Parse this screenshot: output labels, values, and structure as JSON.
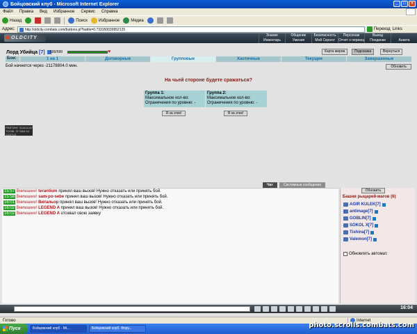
{
  "window": {
    "title": "Бойцовский клуб - Microsoft Internet Explorer"
  },
  "menubar": {
    "items": [
      "Файл",
      "Правка",
      "Вид",
      "Избранное",
      "Сервис",
      "Справка"
    ]
  },
  "toolbar": {
    "back_label": "Назад",
    "search_label": "Поиск",
    "favorites_label": "Избранное",
    "media_label": "Медиа"
  },
  "addressbar": {
    "label": "Адрес:",
    "url": "http://oldcity.combats.com/buttons.pl?battle=0.733150039952125",
    "go_label": "Переход",
    "links_label": "Links"
  },
  "game": {
    "logo": "OLDCITY",
    "topnav": [
      "Знание",
      "Общение",
      "Безопасность",
      "Персонаж",
      "Выход",
      "Инвентарь",
      "Умения",
      "Мой Скролл",
      "Отчет о переводах",
      "Поединки",
      "Анкета"
    ],
    "character": {
      "name": "Лорд Убийца",
      "level": "[7]",
      "hp": "599/599",
      "hp_fraction": 1.0
    },
    "buttons": {
      "map": "Карта миров",
      "hint": "Подсказка",
      "back": "Вернуться",
      "refresh": "Обновить"
    },
    "tabs": {
      "label": "Бои:",
      "items": [
        "1 на 1",
        "Договорные",
        "Групповые",
        "Хаотичные",
        "Текущие",
        "Завершенные"
      ]
    },
    "battle_start": "Бой начнется через -21178804.0 мин.",
    "question": "На чьей стороне будете сражаться?",
    "groups": [
      {
        "title": "Группа 1:",
        "max": "Максимальное кол-во:",
        "limits": "Ограничения по уровню: -"
      },
      {
        "title": "Группа 2:",
        "max": "Максимальное кол-во:",
        "limits": "Ограничения по уровню: -"
      }
    ],
    "join_label": "Я за этих!",
    "banner_lines": [
      "РЕЙТИНГ 0116112478",
      "TOOBL 37 SAN 04",
      "CASTLE"
    ]
  },
  "chat": {
    "tab_chat": "Чат",
    "tab_system": "Системные сообщения",
    "messages": [
      {
        "time": "15:57",
        "warn": "Внимание!",
        "nick": "terantium",
        "text": "принял ваш вызов! Нужно отказать или принять бой."
      },
      {
        "time": "15:58",
        "warn": "Внимание!",
        "nick": "sam-po-sebe",
        "text": "принял ваш вызов! Нужно отказать или принять бой."
      },
      {
        "time": "16:01",
        "warn": "Внимание!",
        "nick": "Витальор",
        "text": "принял ваш вызов! Нужно отказать или принять бой."
      },
      {
        "time": "16:02",
        "warn": "Внимание!",
        "nick": "LEGEND A",
        "text": "принял ваш вызов! Нужно отказать или принять бой."
      },
      {
        "time": "16:02",
        "warn": "Внимание!",
        "nick": "LEGEND A",
        "text": "отозвал свою заявку"
      }
    ],
    "clock": "16:04"
  },
  "room": {
    "update_label": "Обновить",
    "title": "Башня рыцарей-магов (6)",
    "players": [
      "AGIR KULEK[7]",
      "antimage[7]",
      "GOBLIN[7]",
      "SOKOL X[7]",
      "Tishina[7]",
      "Valemon[7]"
    ],
    "auto_update": "Обновлять автомат."
  },
  "statusbar": {
    "text": "Готово",
    "zone": "Internet"
  },
  "taskbar": {
    "start": "Пуск",
    "items": [
      "Бойцовский клуб - Mi...",
      "Бойцовский клуб. Фору..."
    ]
  },
  "watermark": "photo.scrolls.combats.com"
}
